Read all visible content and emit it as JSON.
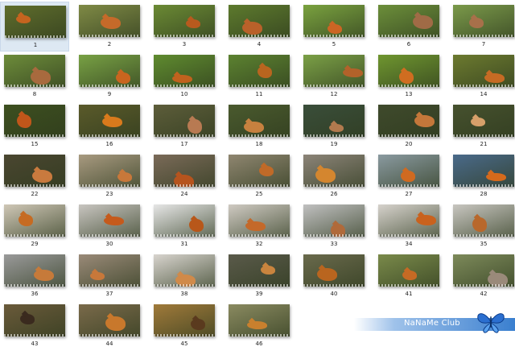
{
  "thumbnails": [
    {
      "label": "1",
      "bg": "#5f6d2c",
      "fox": "#c5641f",
      "selected": true
    },
    {
      "label": "2",
      "bg": "#7f8a45",
      "fox": "#c56a2a"
    },
    {
      "label": "3",
      "bg": "#6b8a34",
      "fox": "#b85a1e"
    },
    {
      "label": "4",
      "bg": "#5d7a2d",
      "fox": "#b9612a"
    },
    {
      "label": "5",
      "bg": "#7aa23f",
      "fox": "#cc6524"
    },
    {
      "label": "6",
      "bg": "#6c8f3a",
      "fox": "#a06b46"
    },
    {
      "label": "7",
      "bg": "#7b9a4a",
      "fox": "#a8704a"
    },
    {
      "label": "8",
      "bg": "#6d8c3a",
      "fox": "#a86a3e"
    },
    {
      "label": "9",
      "bg": "#78a144",
      "fox": "#c9651f"
    },
    {
      "label": "10",
      "bg": "#5f8b2f",
      "fox": "#c0621e"
    },
    {
      "label": "11",
      "bg": "#5c8230",
      "fox": "#b9651f"
    },
    {
      "label": "12",
      "bg": "#7ba046",
      "fox": "#b2622a"
    },
    {
      "label": "13",
      "bg": "#6f962f",
      "fox": "#d06d20"
    },
    {
      "label": "14",
      "bg": "#6c7a2f",
      "fox": "#c66b24"
    },
    {
      "label": "15",
      "bg": "#3d4f1f",
      "fox": "#c0561a"
    },
    {
      "label": "16",
      "bg": "#5a5a2a",
      "fox": "#d97a1c"
    },
    {
      "label": "17",
      "bg": "#5d5d3a",
      "fox": "#b87a52"
    },
    {
      "label": "18",
      "bg": "#4a5a2e",
      "fox": "#c7813f"
    },
    {
      "label": "19",
      "bg": "#3a4e3a",
      "fox": "#b27a4e"
    },
    {
      "label": "20",
      "bg": "#3f4a2c",
      "fox": "#c4773a"
    },
    {
      "label": "21",
      "bg": "#46512e",
      "fox": "#d6a06a"
    },
    {
      "label": "22",
      "bg": "#4a4630",
      "fox": "#c97a3e"
    },
    {
      "label": "23",
      "bg": "#a89a80",
      "fox": "#c8783a"
    },
    {
      "label": "24",
      "bg": "#7a6a58",
      "fox": "#b6541e"
    },
    {
      "label": "25",
      "bg": "#8f8670",
      "fox": "#c06a28"
    },
    {
      "label": "26",
      "bg": "#8c8478",
      "fox": "#d4862f"
    },
    {
      "label": "27",
      "bg": "#8a9aa0",
      "fox": "#d06a20"
    },
    {
      "label": "28",
      "bg": "#4a6a8a",
      "fox": "#d66a1c"
    },
    {
      "label": "29",
      "bg": "#cfc7b6",
      "fox": "#c66b22"
    },
    {
      "label": "30",
      "bg": "#c8c5c0",
      "fox": "#c55a1c"
    },
    {
      "label": "31",
      "bg": "#e6e6e6",
      "fox": "#b8571a"
    },
    {
      "label": "32",
      "bg": "#cfcac2",
      "fox": "#c4692a"
    },
    {
      "label": "33",
      "bg": "#c0c0c0",
      "fox": "#b06a3a"
    },
    {
      "label": "34",
      "bg": "#d6d2cc",
      "fox": "#c9621e"
    },
    {
      "label": "35",
      "bg": "#c8c6c0",
      "fox": "#b8682c"
    },
    {
      "label": "36",
      "bg": "#9a9a9a",
      "fox": "#c67a3a"
    },
    {
      "label": "37",
      "bg": "#9a8a78",
      "fox": "#c8783a"
    },
    {
      "label": "38",
      "bg": "#d8d4ce",
      "fox": "#d08a4a"
    },
    {
      "label": "39",
      "bg": "#5a5a4a",
      "fox": "#c9843e"
    },
    {
      "label": "40",
      "bg": "#6a6a4c",
      "fox": "#b9651f"
    },
    {
      "label": "41",
      "bg": "#7a8a4a",
      "fox": "#c66a24"
    },
    {
      "label": "42",
      "bg": "#7d8a5a",
      "fox": "#9a8a7a"
    },
    {
      "label": "43",
      "bg": "#6a5a3a",
      "fox": "#3a2a1e"
    },
    {
      "label": "44",
      "bg": "#7a6a4a",
      "fox": "#c8782c"
    },
    {
      "label": "45",
      "bg": "#a07a3a",
      "fox": "#5a3a1e"
    },
    {
      "label": "46",
      "bg": "#8a8a60",
      "fox": "#c9802e"
    }
  ],
  "watermark": {
    "text": "NaNaMe Club",
    "icon": "butterfly-icon"
  }
}
